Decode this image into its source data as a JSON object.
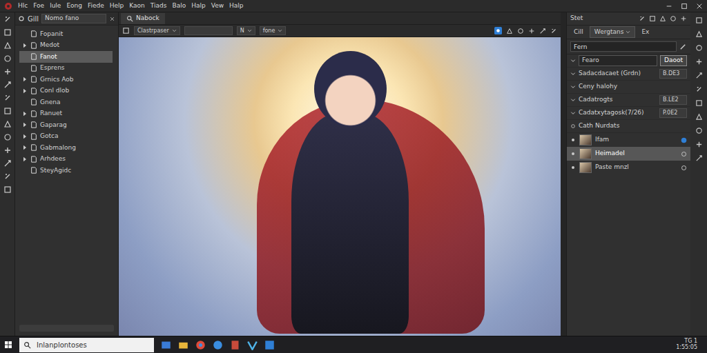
{
  "menu": {
    "items": [
      "Hlc",
      "Foe",
      "lule",
      "Eong",
      "Fiede",
      "Help",
      "Kaon",
      "Tiads",
      "Balo",
      "Halp",
      "Vew",
      "Halp"
    ]
  },
  "left_panel": {
    "tab": "Gill",
    "dropdown": "Nomo fano",
    "items": [
      {
        "label": "Fopanit",
        "expandable": false,
        "expanded": false,
        "selected": false
      },
      {
        "label": "Medot",
        "expandable": true,
        "expanded": false,
        "selected": false
      },
      {
        "label": "Fanot",
        "expandable": false,
        "expanded": false,
        "selected": true
      },
      {
        "label": "Esprens",
        "expandable": false,
        "expanded": false,
        "selected": false
      },
      {
        "label": "Grnics Aob",
        "expandable": true,
        "expanded": false,
        "selected": false
      },
      {
        "label": "Conl dlob",
        "expandable": true,
        "expanded": false,
        "selected": false
      },
      {
        "label": "Gnena",
        "expandable": false,
        "expanded": false,
        "selected": false
      },
      {
        "label": "Ranuet",
        "expandable": true,
        "expanded": false,
        "selected": false
      },
      {
        "label": "Gaparag",
        "expandable": true,
        "expanded": false,
        "selected": false
      },
      {
        "label": "Gotca",
        "expandable": true,
        "expanded": false,
        "selected": false
      },
      {
        "label": "Gabmalong",
        "expandable": true,
        "expanded": false,
        "selected": false
      },
      {
        "label": "Arhdees",
        "expandable": true,
        "expanded": false,
        "selected": false
      },
      {
        "label": "SteyAgidc",
        "expandable": false,
        "expanded": false,
        "selected": false
      }
    ]
  },
  "document": {
    "tab": "Nabock",
    "toolbar": [
      "Clastrpaser",
      "N",
      "fone"
    ]
  },
  "right_panel": {
    "title": "Stet",
    "tabs": [
      {
        "label": "Cill",
        "selected": false
      },
      {
        "label": "Wergtans",
        "selected": true
      },
      {
        "label": "Ex",
        "selected": false
      }
    ],
    "search": {
      "value": "Fern"
    },
    "properties": [
      {
        "kind": "field",
        "label": "Fearo",
        "button": "Daoot",
        "expanded": true
      },
      {
        "kind": "value",
        "label": "Sadacdacaet (Grdn)",
        "reading": "B.DE3",
        "expanded": true
      },
      {
        "kind": "header",
        "label": "Ceny halohy",
        "expanded": true
      },
      {
        "kind": "value",
        "label": "Cadatrogts",
        "reading": "B.LE2",
        "expanded": true
      },
      {
        "kind": "value",
        "label": "Cadatxytagosk(7/26)",
        "reading": "P.0E2",
        "expanded": true
      },
      {
        "kind": "header",
        "label": "Cath Nurdats",
        "expanded": false
      }
    ],
    "layers": [
      {
        "name": "Ifam",
        "visible": true,
        "selected": false
      },
      {
        "name": "Heimadel",
        "visible": true,
        "selected": true
      },
      {
        "name": "Paste mnzl",
        "visible": true,
        "selected": false
      }
    ]
  },
  "taskbar": {
    "search": {
      "placeholder": "Inlanplontoses"
    },
    "clock": {
      "date": "TG 1",
      "time": "1:55:05"
    }
  }
}
